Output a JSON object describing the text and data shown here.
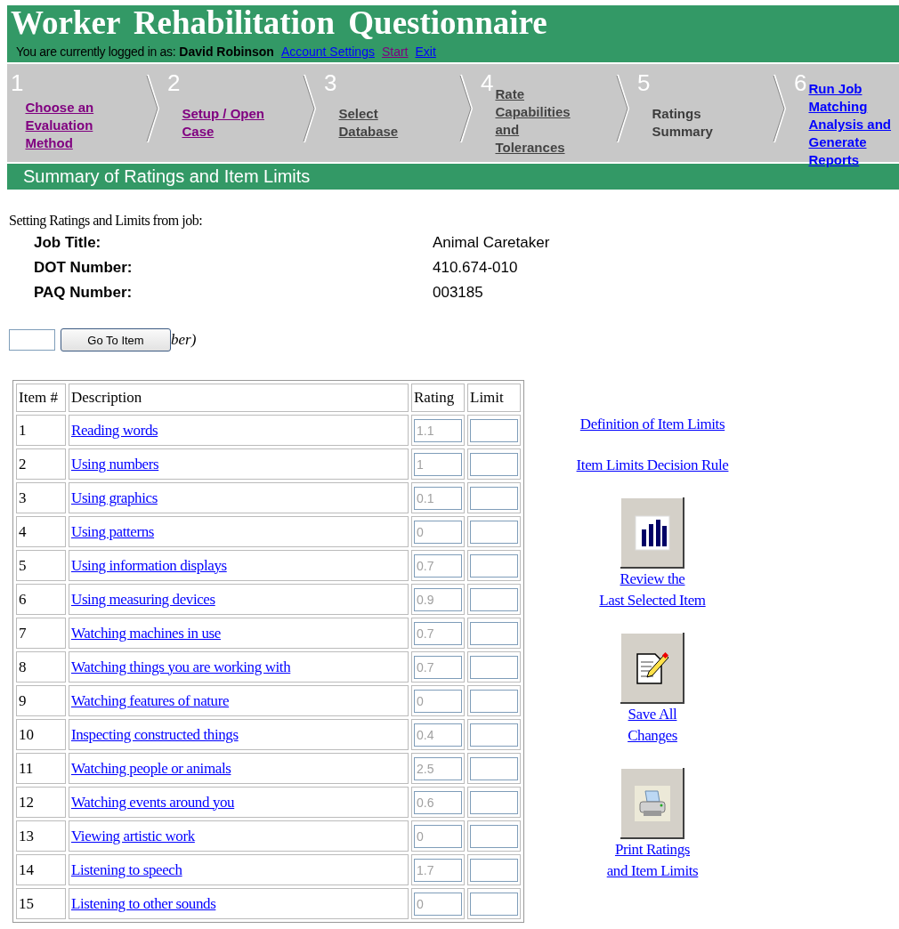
{
  "header": {
    "title": "Worker Rehabilitation Questionnaire",
    "login_prefix": "You are currently logged in as:",
    "user": "David Robinson",
    "links": [
      {
        "label": "Account Settings",
        "visited": false
      },
      {
        "label": "Start",
        "visited": true
      },
      {
        "label": "Exit",
        "visited": false
      }
    ]
  },
  "steps": [
    {
      "number": "1",
      "label": "Choose an Evaluation Method",
      "visited": true,
      "disabled": false,
      "current": false
    },
    {
      "number": "2",
      "label": "Setup / Open Case",
      "visited": true,
      "disabled": false,
      "current": false
    },
    {
      "number": "3",
      "label": "Select Database",
      "visited": false,
      "disabled": true,
      "current": false
    },
    {
      "number": "4",
      "label": "Rate Capabilities and Tolerances",
      "visited": false,
      "disabled": true,
      "current": false
    },
    {
      "number": "5",
      "label": "Ratings Summary",
      "visited": false,
      "disabled": false,
      "current": true
    },
    {
      "number": "6",
      "label": "Run Job Matching Analysis and Generate Reports",
      "visited": false,
      "disabled": false,
      "current": false
    }
  ],
  "section_title": "Summary of Ratings and Item Limits",
  "intro": "Setting Ratings and Limits from job:",
  "job_info": [
    {
      "label": "Job Title:",
      "value": "Animal Caretaker"
    },
    {
      "label": "DOT Number:",
      "value": "410.674-010"
    },
    {
      "label": "PAQ Number:",
      "value": "003185"
    }
  ],
  "go_to": {
    "button": "Go To Item",
    "hint": "ber)"
  },
  "table": {
    "columns": [
      "Item #",
      "Description",
      "Rating",
      "Limit"
    ],
    "rows": [
      {
        "item": "1",
        "description": "Reading words",
        "rating": "1.1"
      },
      {
        "item": "2",
        "description": "Using numbers",
        "rating": "1"
      },
      {
        "item": "3",
        "description": "Using graphics",
        "rating": "0.1"
      },
      {
        "item": "4",
        "description": "Using patterns",
        "rating": "0"
      },
      {
        "item": "5",
        "description": "Using information displays",
        "rating": "0.7"
      },
      {
        "item": "6",
        "description": "Using measuring devices",
        "rating": "0.9"
      },
      {
        "item": "7",
        "description": "Watching machines in use",
        "rating": "0.7"
      },
      {
        "item": "8",
        "description": "Watching things you are working with",
        "rating": "0.7"
      },
      {
        "item": "9",
        "description": "Watching features of nature",
        "rating": "0"
      },
      {
        "item": "10",
        "description": "Inspecting constructed things",
        "rating": "0.4"
      },
      {
        "item": "11",
        "description": "Watching people or animals",
        "rating": "2.5"
      },
      {
        "item": "12",
        "description": "Watching events around you",
        "rating": "0.6"
      },
      {
        "item": "13",
        "description": "Viewing artistic work",
        "rating": "0"
      },
      {
        "item": "14",
        "description": "Listening to speech",
        "rating": "1.7"
      },
      {
        "item": "15",
        "description": "Listening to other sounds",
        "rating": "0"
      }
    ]
  },
  "side_links": [
    "Definition of Item Limits",
    "Item Limits Decision Rule"
  ],
  "actions": [
    {
      "kind": "chart",
      "label": "Review the\nLast Selected Item"
    },
    {
      "kind": "edit",
      "label": "Save All\nChanges"
    },
    {
      "kind": "print",
      "label": "Print Ratings\nand Item Limits"
    }
  ]
}
